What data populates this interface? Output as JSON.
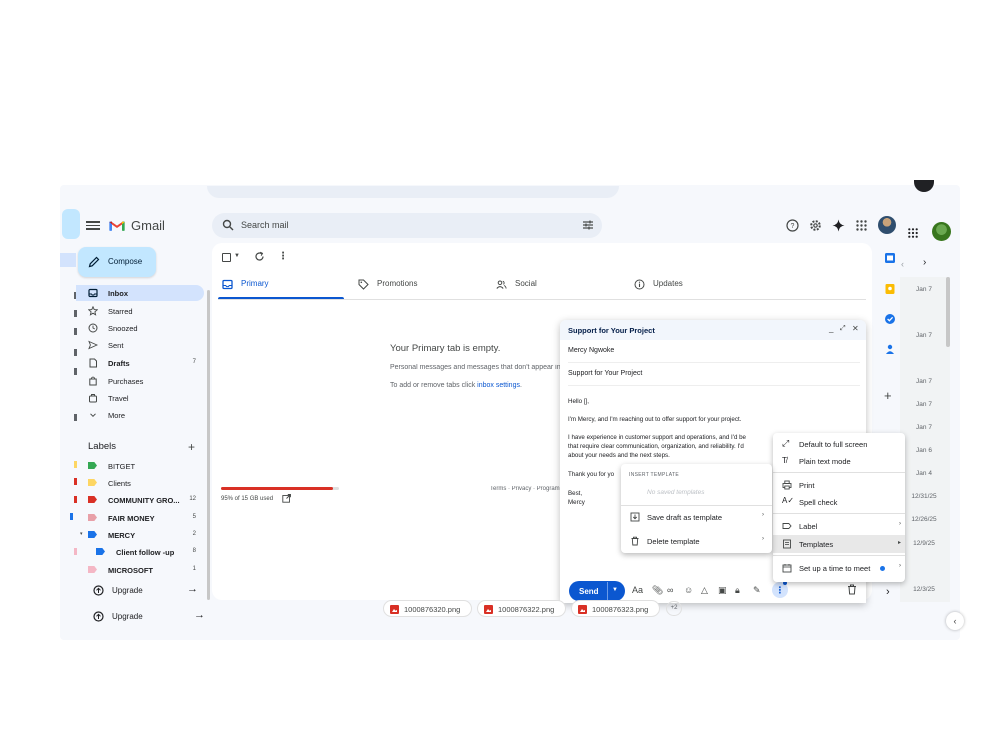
{
  "app": {
    "name": "Gmail",
    "search_placeholder": "Search mail"
  },
  "compose_button": {
    "label": "Compose"
  },
  "sidebar": {
    "items": [
      {
        "label": "Inbox",
        "count": "",
        "icon": "inbox-icon",
        "active": true
      },
      {
        "label": "Starred",
        "count": "",
        "icon": "star-icon"
      },
      {
        "label": "Snoozed",
        "count": "",
        "icon": "clock-icon"
      },
      {
        "label": "Sent",
        "count": "",
        "icon": "send-icon"
      },
      {
        "label": "Drafts",
        "count": "7",
        "icon": "draft-icon"
      },
      {
        "label": "Purchases",
        "count": "",
        "icon": "shopping-bag-icon"
      },
      {
        "label": "Travel",
        "count": "",
        "icon": "suitcase-icon"
      },
      {
        "label": "More",
        "count": "",
        "icon": "chevron-down-icon"
      }
    ],
    "labels_heading": "Labels",
    "labels": [
      {
        "label": "BITGET",
        "count": "",
        "color": "#34a853"
      },
      {
        "label": "Clients",
        "count": "",
        "color": "#fdd663"
      },
      {
        "label": "COMMUNITY GRO...",
        "count": "12",
        "color": "#d93025"
      },
      {
        "label": "FAIR MONEY",
        "count": "5",
        "color": "#e8a0a8"
      },
      {
        "label": "MERCY",
        "count": "2",
        "color": "#1a73e8"
      },
      {
        "label": "Client follow -up",
        "count": "8",
        "color": "#1a73e8"
      },
      {
        "label": "MICROSOFT",
        "count": "1",
        "color": "#f4b7c5"
      }
    ],
    "upgrade_label": "Upgrade",
    "upgrade_label_2": "Upgrade"
  },
  "tabs": [
    {
      "label": "Primary",
      "icon": "inbox-icon"
    },
    {
      "label": "Promotions",
      "icon": "tag-icon"
    },
    {
      "label": "Social",
      "icon": "people-icon"
    },
    {
      "label": "Updates",
      "icon": "info-icon"
    }
  ],
  "empty_state": {
    "title": "Your Primary tab is empty.",
    "line1": "Personal messages and messages that don't appear in other tabs will be shown here.",
    "line2_prefix": "To add or remove tabs click ",
    "line2_link": "inbox settings",
    "line2_suffix": "."
  },
  "storage": {
    "text": "95% of 15 GB used",
    "fraction": 0.95
  },
  "footer": {
    "links": "Terms · Privacy · Program Policies"
  },
  "dates": [
    "Jan 7",
    "Jan 7",
    "Jan 7",
    "Jan 7",
    "Jan 7",
    "Jan 6",
    "Jan 4",
    "12/31/25",
    "12/26/25",
    "12/9/25",
    "12/3/25"
  ],
  "compose": {
    "title": "Support for Your Project",
    "to": "Mercy Ngwoke",
    "subject": "Support for Your Project",
    "body_lines": [
      "Hello [],",
      "I'm Mercy, and I'm reaching out to offer support for your project.",
      "I have experience in customer support and operations, and I'd be",
      "that require clear communication, organization, and reliability. I'd",
      "about your needs and the next steps.",
      "Thank you for yo",
      "Best,",
      "Mercy"
    ],
    "send_label": "Send",
    "format_label": "Aa"
  },
  "attachments": [
    "1000876320.png",
    "1000876322.png",
    "1000876323.png"
  ],
  "attachments_more": "+2",
  "more_menu": {
    "items": [
      {
        "label": "Default to full screen",
        "icon": "expand-icon"
      },
      {
        "label": "Plain text mode",
        "icon": "plain-text-icon"
      },
      {
        "label": "Print",
        "icon": "print-icon"
      },
      {
        "label": "Spell check",
        "icon": "spell-check-icon"
      },
      {
        "label": "Label",
        "icon": "label-icon"
      },
      {
        "label": "Templates",
        "icon": "template-icon"
      },
      {
        "label": "Set up a time to meet",
        "icon": "calendar-icon"
      }
    ]
  },
  "templates_menu": {
    "heading": "INSERT TEMPLATE",
    "empty_text": "No saved templates",
    "items": [
      {
        "label": "Save draft as template",
        "icon": "save-template-icon"
      },
      {
        "label": "Delete template",
        "icon": "delete-icon"
      }
    ]
  },
  "colors": {
    "accent": "#0b57d0",
    "compose_bg": "#c2e7ff",
    "active_nav": "#d3e3fd",
    "storage_fill": "#d93025"
  }
}
